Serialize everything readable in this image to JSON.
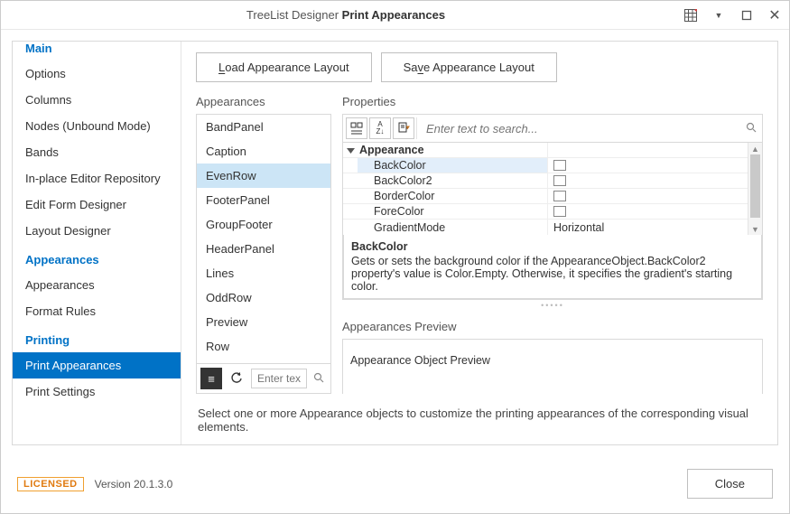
{
  "title": {
    "prefix": "TreeList Designer",
    "section": "Print Appearances"
  },
  "buttons": {
    "load_appearance": "Load Appearance Layout",
    "save_appearance": "Save Appearance Layout",
    "close": "Close"
  },
  "sidebar": {
    "groups": [
      {
        "heading": "Main",
        "cut": true,
        "items": [
          {
            "label": "Options"
          },
          {
            "label": "Columns"
          },
          {
            "label": "Nodes (Unbound Mode)"
          },
          {
            "label": "Bands"
          },
          {
            "label": "In-place Editor Repository"
          },
          {
            "label": "Edit Form Designer"
          },
          {
            "label": "Layout Designer"
          }
        ]
      },
      {
        "heading": "Appearances",
        "items": [
          {
            "label": "Appearances"
          },
          {
            "label": "Format Rules"
          }
        ]
      },
      {
        "heading": "Printing",
        "items": [
          {
            "label": "Print Appearances",
            "selected": true
          },
          {
            "label": "Print Settings"
          }
        ]
      }
    ]
  },
  "appearances": {
    "heading": "Appearances",
    "items": [
      {
        "label": "BandPanel"
      },
      {
        "label": "Caption"
      },
      {
        "label": "EvenRow",
        "selected": true
      },
      {
        "label": "FooterPanel"
      },
      {
        "label": "GroupFooter"
      },
      {
        "label": "HeaderPanel"
      },
      {
        "label": "Lines"
      },
      {
        "label": "OddRow"
      },
      {
        "label": "Preview"
      },
      {
        "label": "Row"
      }
    ],
    "search_placeholder": "Enter text to s"
  },
  "properties": {
    "heading": "Properties",
    "search_placeholder": "Enter text to search...",
    "category": "Appearance",
    "rows": [
      {
        "name": "BackColor",
        "type": "color",
        "value": "",
        "selected": true
      },
      {
        "name": "BackColor2",
        "type": "color",
        "value": ""
      },
      {
        "name": "BorderColor",
        "type": "color",
        "value": ""
      },
      {
        "name": "ForeColor",
        "type": "color",
        "value": ""
      },
      {
        "name": "GradientMode",
        "type": "text",
        "value": "Horizontal"
      }
    ],
    "description": {
      "title": "BackColor",
      "text": "Gets or sets the background color if the AppearanceObject.BackColor2 property's value is Color.Empty. Otherwise, it specifies the gradient's starting color."
    }
  },
  "preview": {
    "heading": "Appearances Preview",
    "content": "Appearance Object Preview"
  },
  "hint": "Select one or more Appearance objects to customize the printing appearances of the corresponding visual elements.",
  "footer": {
    "license": "LICENSED",
    "version": "Version 20.1.3.0"
  },
  "icons": {
    "categorized": "≣",
    "alphabetical": "A↓",
    "pages": "📄",
    "refresh": "↻",
    "list": "≡",
    "search": "🔍",
    "expand": "▼"
  }
}
